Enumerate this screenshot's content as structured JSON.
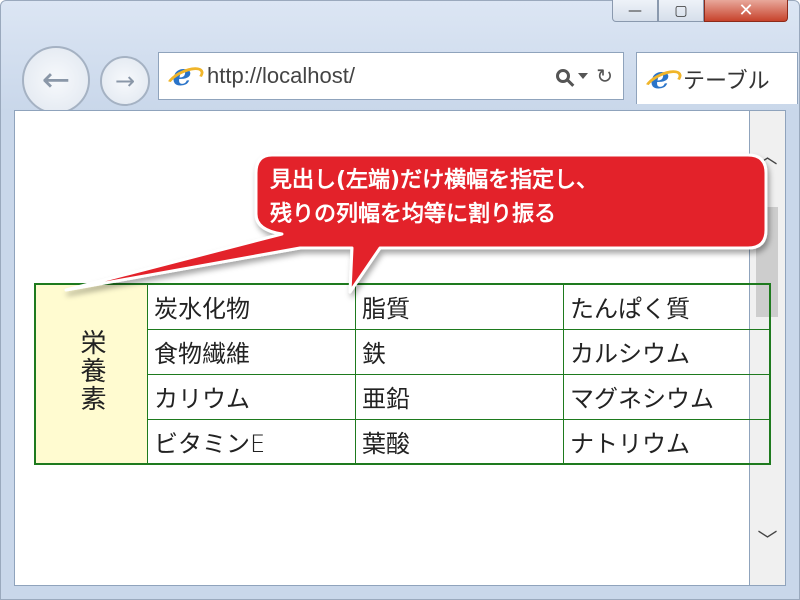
{
  "window": {
    "minimize_glyph": "—",
    "maximize_glyph": "▢",
    "close_glyph": "✕"
  },
  "nav": {
    "back_glyph": "←",
    "forward_glyph": "→"
  },
  "address": {
    "url": "http://localhost/",
    "browser_icon": "ie-e-icon",
    "search_icon": "magnifier-icon",
    "dropdown_icon": "dropdown-triangle-icon",
    "refresh_glyph": "↻"
  },
  "tab": {
    "title": "テーブル"
  },
  "scrollbar": {
    "up_glyph": "︿",
    "down_glyph": "﹀"
  },
  "callout": {
    "line1": "見出し(左端)だけ横幅を指定し、",
    "line2": "残りの列幅を均等に割り振る",
    "fill_color": "#e3202a"
  },
  "table": {
    "header": "栄養素",
    "header_bg": "#fffbd0",
    "border_color": "#1e7a1e",
    "rows": [
      [
        "炭水化物",
        "脂質",
        "たんぱく質"
      ],
      [
        "食物繊維",
        "鉄",
        "カルシウム"
      ],
      [
        "カリウム",
        "亜鉛",
        "マグネシウム"
      ],
      [
        "ビタミンE",
        "葉酸",
        "ナトリウム"
      ]
    ]
  }
}
